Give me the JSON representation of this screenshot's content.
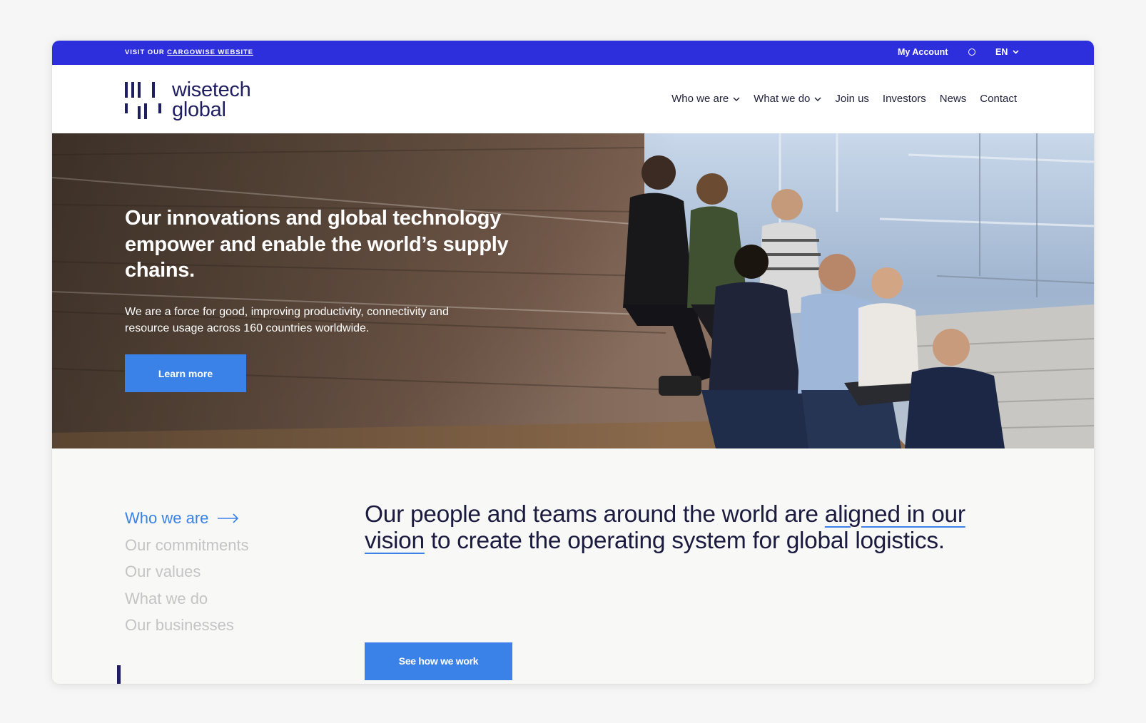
{
  "topbar": {
    "visit_prefix": "VISIT OUR",
    "visit_link": "CARGOWISE WEBSITE",
    "my_account": "My Account",
    "language": "EN"
  },
  "header": {
    "logo_line1": "wisetech",
    "logo_line2": "global",
    "nav": [
      "Who we are",
      "What we do",
      "Join us",
      "Investors",
      "News",
      "Contact"
    ]
  },
  "hero": {
    "title": "Our innovations and global technology empower and enable the world’s supply chains.",
    "subtitle": "We are a force for good, improving productivity, connectivity and resource usage across 160 countries worldwide.",
    "cta": "Learn more"
  },
  "section": {
    "side_nav": [
      "Who we are",
      "Our commitments",
      "Our values",
      "What we do",
      "Our businesses"
    ],
    "statement_part1": "Our people and teams around the world are ",
    "statement_highlight": "aligned in our vision",
    "statement_part2": " to create the operating system for global logistics.",
    "cta": "See how we work"
  },
  "colors": {
    "topbar": "#2d2fdd",
    "brand_navy": "#1e1e60",
    "accent_blue": "#3b82e8",
    "inactive_text": "#c4c4c6"
  }
}
